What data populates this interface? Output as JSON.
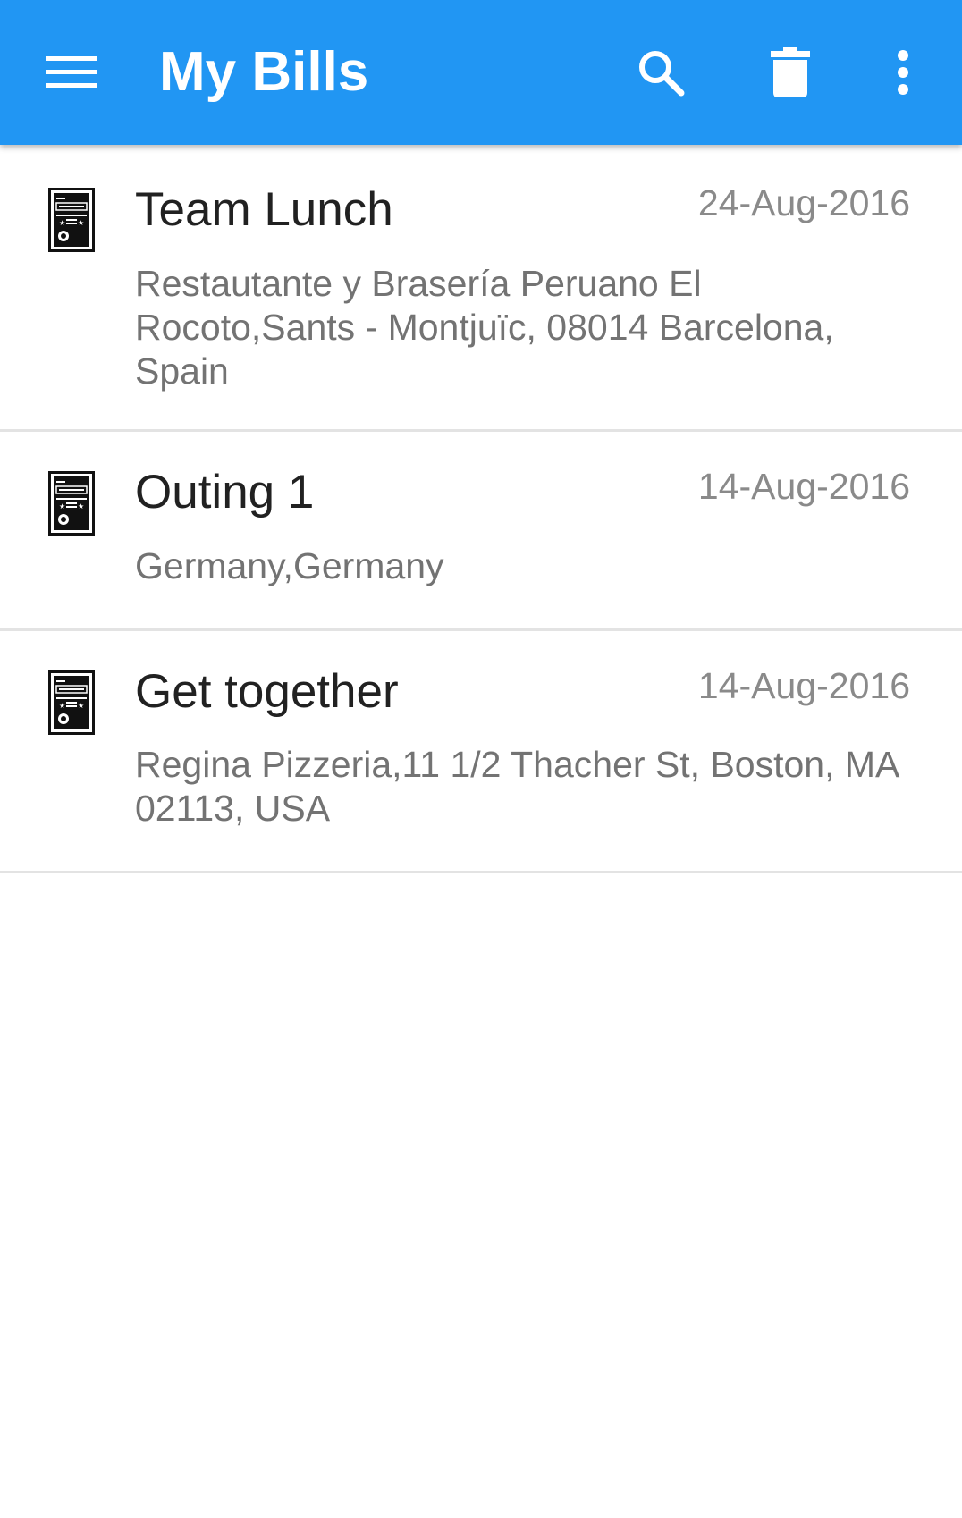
{
  "app": {
    "title": "My Bills",
    "accent_color": "#2196F3"
  },
  "toolbar": {
    "menu_icon": "hamburger-menu-icon",
    "search_icon": "search-icon",
    "delete_icon": "trash-icon",
    "more_icon": "more-vertical-icon"
  },
  "bills": [
    {
      "name": "Team Lunch",
      "date": "24-Aug-2016",
      "address": "Restautante y Brasería Peruano El Rocoto,Sants - Montjuïc, 08014 Barcelona, Spain",
      "icon": "bill-receipt-icon"
    },
    {
      "name": "Outing 1",
      "date": "14-Aug-2016",
      "address": "Germany,Germany",
      "icon": "bill-receipt-icon"
    },
    {
      "name": "Get together",
      "date": "14-Aug-2016",
      "address": "Regina Pizzeria,11 1/2 Thacher St, Boston, MA 02113, USA",
      "icon": "bill-receipt-icon"
    }
  ]
}
